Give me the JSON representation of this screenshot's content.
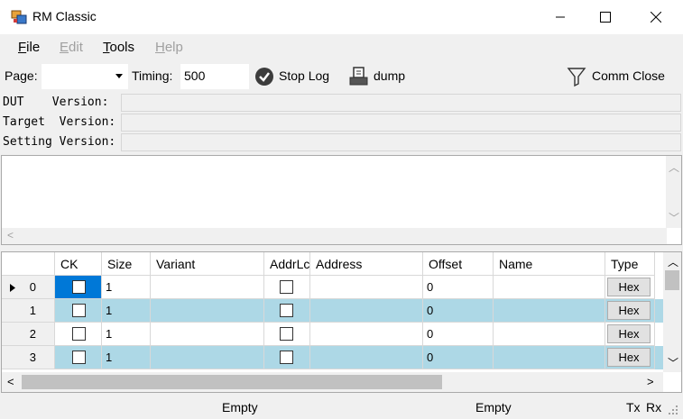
{
  "window": {
    "title": "RM Classic"
  },
  "menu": {
    "file": "File",
    "edit": "Edit",
    "tools": "Tools",
    "help": "Help"
  },
  "toolbar": {
    "page_label": "Page:",
    "page_value": "",
    "timing_label": "Timing:",
    "timing_value": "500",
    "stop_log_label": "Stop Log",
    "dump_label": "dump",
    "comm_close_label": "Comm Close"
  },
  "versions": [
    {
      "label": "DUT    Version:",
      "value": ""
    },
    {
      "label": "Target  Version:",
      "value": ""
    },
    {
      "label": "Setting Version:",
      "value": ""
    }
  ],
  "grid": {
    "columns": [
      "CK",
      "Size",
      "Variant",
      "AddrLc",
      "Address",
      "Offset",
      "Name",
      "Type"
    ],
    "rows": [
      {
        "index": "0",
        "ck": false,
        "size": "1",
        "variant": "",
        "addrlc": false,
        "address": "",
        "offset": "0",
        "name": "",
        "type": "Hex",
        "current": true
      },
      {
        "index": "1",
        "ck": false,
        "size": "1",
        "variant": "",
        "addrlc": false,
        "address": "",
        "offset": "0",
        "name": "",
        "type": "Hex",
        "current": false
      },
      {
        "index": "2",
        "ck": false,
        "size": "1",
        "variant": "",
        "addrlc": false,
        "address": "",
        "offset": "0",
        "name": "",
        "type": "Hex",
        "current": false
      },
      {
        "index": "3",
        "ck": false,
        "size": "1",
        "variant": "",
        "addrlc": false,
        "address": "",
        "offset": "0",
        "name": "",
        "type": "Hex",
        "current": false
      }
    ]
  },
  "status": {
    "left": "Empty",
    "right": "Empty",
    "tx": "Tx",
    "rx": "Rx"
  },
  "colors": {
    "alt_row": "#add8e6",
    "selected_cell": "#0078d7"
  }
}
